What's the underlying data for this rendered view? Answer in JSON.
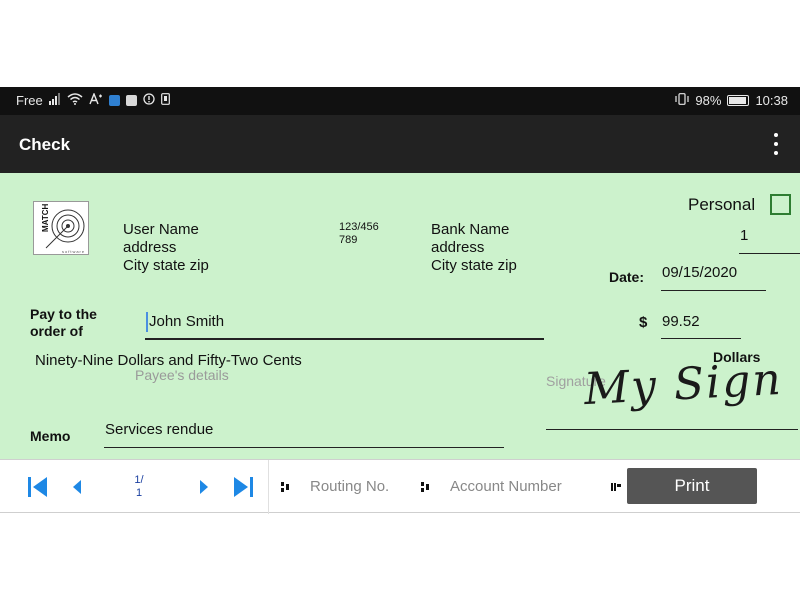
{
  "status_bar": {
    "carrier": "Free",
    "battery_pct": "98%",
    "time": "10:38"
  },
  "app_bar": {
    "title": "Check",
    "menu_icon": "overflow-menu-icon"
  },
  "check": {
    "logo_text": "MATCH",
    "logo_subtext": "software",
    "personal_label": "Personal",
    "check_number": "1",
    "user": {
      "name": "User Name",
      "address": "address",
      "city": "City state zip"
    },
    "routing_fraction": {
      "top": "123/456",
      "bottom": "789"
    },
    "bank": {
      "name": "Bank Name",
      "address": "address",
      "city": "City state zip"
    },
    "date_label": "Date:",
    "date_value": "09/15/2020",
    "pay_to_label_1": "Pay to the",
    "pay_to_label_2": "order of",
    "payee": "John Smith",
    "dollar_sign": "$",
    "amount": "99.52",
    "amount_words": "Ninety-Nine Dollars and Fifty-Two Cents",
    "dollars_label": "Dollars",
    "payee_details_placeholder": "Payee's details",
    "signature_placeholder": "Signature",
    "signature_text": "My Sign",
    "memo_label": "Memo",
    "memo_value": "Services rendue"
  },
  "nav": {
    "page_current": "1/",
    "page_total": "1",
    "routing_placeholder": "Routing No.",
    "account_placeholder": "Account Number",
    "print_label": "Print"
  },
  "colors": {
    "check_bg": "#ccf2cc",
    "nav_blue": "#1e88e5",
    "checkbox_green": "#2e7d32",
    "print_bg": "#555555"
  }
}
